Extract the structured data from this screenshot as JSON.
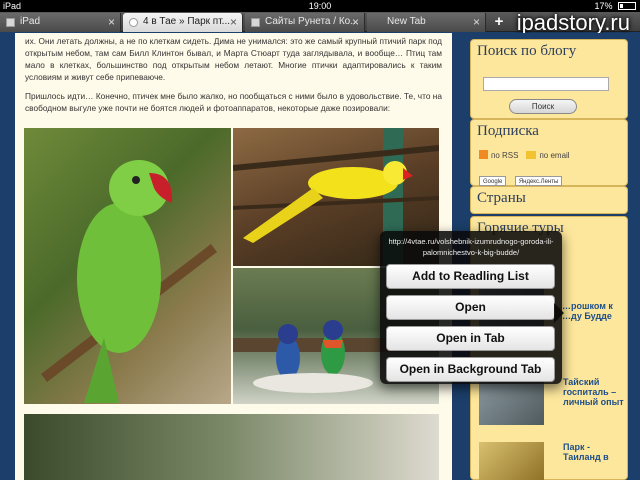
{
  "status": {
    "device": "iPad",
    "time": "19:00",
    "battery": "17%"
  },
  "watermark": "ipadstory.ru",
  "tabs": [
    {
      "label": "iPad",
      "active": false
    },
    {
      "label": "4 в Тае » Парк пт...",
      "active": true
    },
    {
      "label": "Сайты Рунета / Ко...",
      "active": false
    },
    {
      "label": "New Tab",
      "active": false
    }
  ],
  "article": {
    "p1": "их. Они летать должны, а не по клеткам сидеть. Дима не унимался: это же самый крупный птичий парк под открытым небом, там сам Билл Клинтон бывал, и Марта Стюарт туда заглядывала, и вообще… Птиц там мало в клетках, большинство под открытым небом летают. Многие птички адаптировались к таким условиям и живут себе припеваюче.",
    "p2": "Пришлось идти… Конечно, птичек мне было жалко, но пообщаться с ними было в удовольствие. Те, что на свободном выгуле уже почти не боятся людей и фотоаппаратов, некоторые даже позировали:"
  },
  "sidebar": {
    "search_title": "Поиск по блогу",
    "search_button": "Поиск",
    "subscribe_title": "Подписка",
    "rss_label": "по RSS",
    "email_label": "по email",
    "badge_google": "Google",
    "badge_yandex": "Яндекс.Ленты",
    "countries_title": "Страны",
    "hot_tours_title": "Горячие туры",
    "item1_title": "…рошком к …ду Будде",
    "item2_title": "Тайский госпиталь – личный опыт",
    "item3_title": "Парк - Таиланд в"
  },
  "popover": {
    "url": "http://4vtae.ru/volshebnik-izumrudnogo-goroda-ili-palomnichestvo-k-big-budde/",
    "add_reading_list": "Add to Readling List",
    "open": "Open",
    "open_in_tab": "Open in Tab",
    "open_background": "Open in Background Tab"
  }
}
